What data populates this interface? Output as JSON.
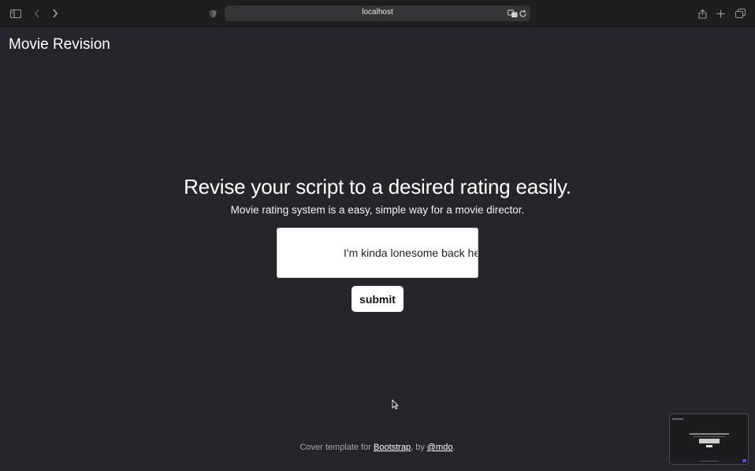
{
  "browser": {
    "url": "localhost",
    "icons": [
      "sidebar-icon",
      "back-icon",
      "forward-icon",
      "shield-icon",
      "translate-icon",
      "reload-icon",
      "share-icon",
      "new-tab-icon",
      "tabs-overview-icon"
    ]
  },
  "page": {
    "brand": "Movie Revision",
    "headline": "Revise your script to a desired rating easily.",
    "subline": "Movie rating system is a easy, simple way for a movie director.",
    "script_input": {
      "value": "I'm kinda lonesome back here"
    },
    "submit_label": "submit"
  },
  "footer": {
    "prefix": "Cover template for ",
    "bootstrap_link": "Bootstrap",
    "middle": ", by ",
    "mdo_link": "@mdo",
    "suffix": "."
  },
  "colors": {
    "background": "#25262b",
    "toolbar": "#1f1e1f",
    "urlbar": "#353436",
    "text": "#ffffff",
    "footer_text": "#a6a6a8"
  }
}
